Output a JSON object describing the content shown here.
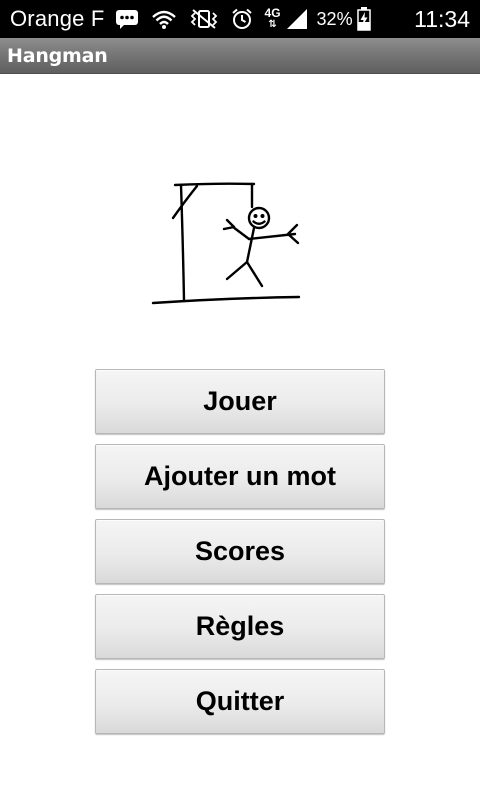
{
  "status_bar": {
    "carrier": "Orange F",
    "network": "4G",
    "battery_percent": "32%",
    "time": "11:34",
    "icons": [
      "bbm-chat-icon",
      "wifi-icon",
      "vibrate-icon",
      "alarm-icon",
      "network-4g-icon",
      "signal-icon",
      "battery-charging-icon"
    ]
  },
  "app_bar": {
    "title": "Hangman"
  },
  "illustration": {
    "icon": "hangman-drawing"
  },
  "menu": {
    "buttons": [
      "Jouer",
      "Ajouter un mot",
      "Scores",
      "Règles",
      "Quitter"
    ]
  },
  "colors": {
    "status_bar": "#000000",
    "title_bar": "#777777",
    "background": "#ffffff",
    "button_face": "#ebebeb",
    "button_text": "#000000"
  }
}
